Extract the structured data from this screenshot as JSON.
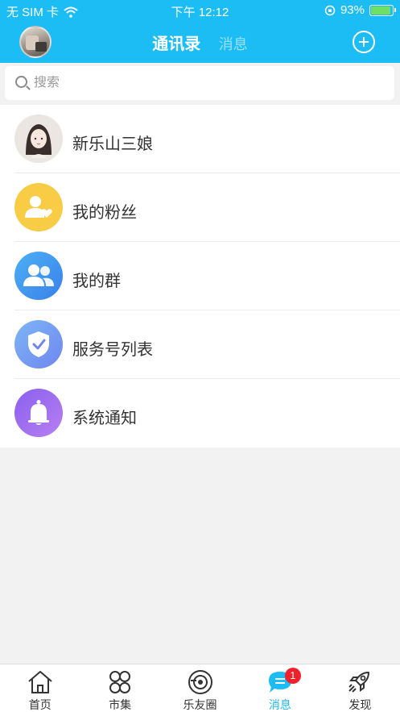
{
  "status_bar": {
    "carrier": "无 SIM 卡",
    "time": "下午 12:12",
    "battery": "93%",
    "battery_level": 0.93
  },
  "header": {
    "active_tab": "通讯录",
    "other_tab": "消息",
    "icons": [
      "avatar",
      "add-circle-icon"
    ]
  },
  "search": {
    "placeholder": "搜索",
    "value": ""
  },
  "contacts": [
    {
      "label": "新乐山三娘",
      "icon": "user-avatar",
      "color": "#e7e0dc"
    },
    {
      "label": "我的粉丝",
      "icon": "fans-icon",
      "color": "#f9cc46"
    },
    {
      "label": "我的群",
      "icon": "group-icon",
      "color": "#3f8ff0"
    },
    {
      "label": "服务号列表",
      "icon": "shield-check-icon",
      "color": "#6f9cf2"
    },
    {
      "label": "系统通知",
      "icon": "bell-icon",
      "color": "#9a6af0"
    }
  ],
  "tabbar": {
    "items": [
      {
        "label": "首页",
        "icon": "home-icon"
      },
      {
        "label": "市集",
        "icon": "grid-icon"
      },
      {
        "label": "乐友圈",
        "icon": "circle-camera-icon"
      },
      {
        "label": "消息",
        "icon": "message-icon",
        "badge": "1",
        "active": true
      },
      {
        "label": "发现",
        "icon": "rocket-icon"
      }
    ]
  },
  "colors": {
    "accent": "#1cbdf5",
    "badge": "#f0212b",
    "background": "#f2f2f2"
  }
}
